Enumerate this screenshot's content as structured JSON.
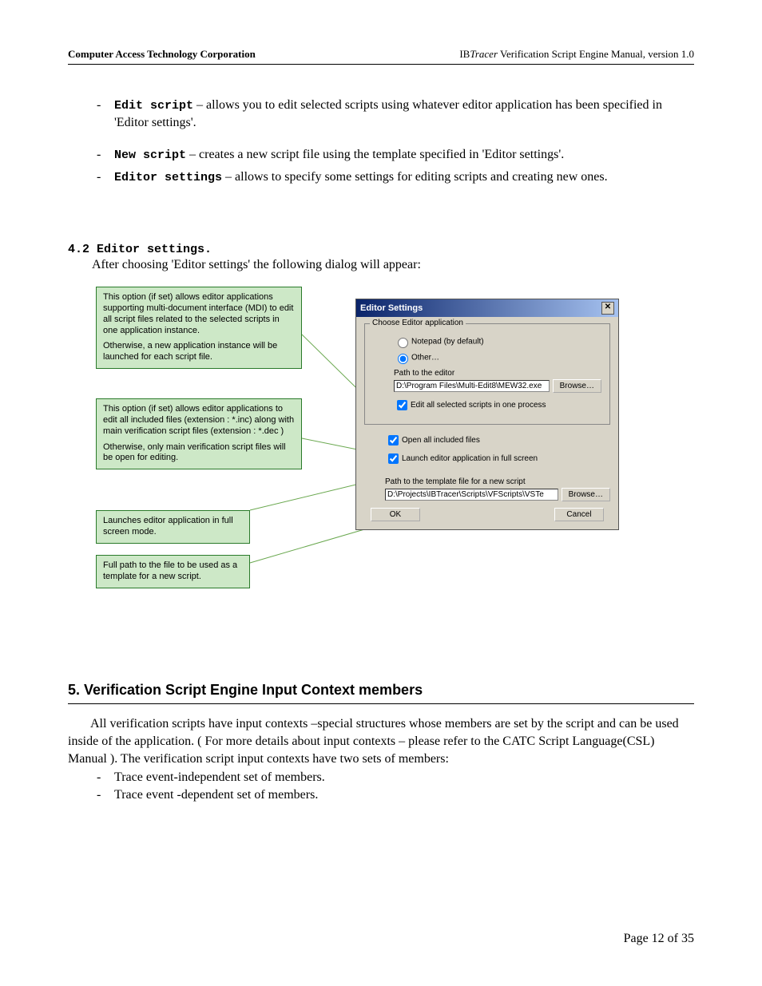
{
  "header": {
    "left": "Computer Access Technology Corporation",
    "right_prefix": "IB",
    "right_italic": "Tracer",
    "right_suffix": " Verification Script Engine Manual, version 1.0"
  },
  "bullets_top": {
    "edit_cmd": "Edit script",
    "edit_desc": " – allows you to edit selected scripts using whatever editor application has been specified in 'Editor settings'.",
    "new_cmd": "New script",
    "new_desc": " – creates a new script file using the template specified in 'Editor settings'.",
    "editor_cmd": "Editor settings",
    "editor_desc": " – allows to specify some settings for editing scripts and creating new ones."
  },
  "sec42": {
    "num": "4.2",
    "title": " Editor settings.",
    "para": "After choosing 'Editor settings' the following dialog will appear:"
  },
  "callouts": {
    "c1a": "This option (if set) allows editor applications supporting multi-document interface (MDI) to edit all script files related to the selected scripts in one application instance.",
    "c1b": "Otherwise, a new application instance will be launched for each script file.",
    "c2a": "This option (if set) allows editor applications to edit all included files (extension : *.inc) along with main verification script files (extension :  *.dec )",
    "c2b": "Otherwise, only main verification script files will be open for editing.",
    "c3": "Launches editor application in full screen mode.",
    "c4": "Full path to the file to be used as a template for a new script."
  },
  "dialog": {
    "title": "Editor Settings",
    "group_label": "Choose Editor application",
    "radio_notepad": "Notepad (by default)",
    "radio_other": "Other…",
    "path_label": "Path to the editor",
    "path_value": "D:\\Program Files\\Multi-Edit8\\MEW32.exe",
    "browse": "Browse…",
    "chk_process": "Edit all selected scripts in one process",
    "chk_open_inc": "Open all included files",
    "chk_fullscreen": "Launch editor application in full screen",
    "template_label": "Path to the template file for a new script",
    "template_value": "D:\\Projects\\IBTracer\\Scripts\\VFScripts\\VSTe",
    "ok": "OK",
    "cancel": "Cancel"
  },
  "sec5": {
    "title": "5.  Verification Script Engine Input Context members",
    "para": "All verification scripts have input contexts –special structures whose members are set by the script and can be used inside of the application.  ( For more details about input contexts – please refer to the CATC Script Language(CSL) Manual ). The verification script input contexts have two sets of members:",
    "b1": "Trace event-independent set of members.",
    "b2": "Trace event -dependent set of members."
  },
  "footer": "Page 12 of 35"
}
